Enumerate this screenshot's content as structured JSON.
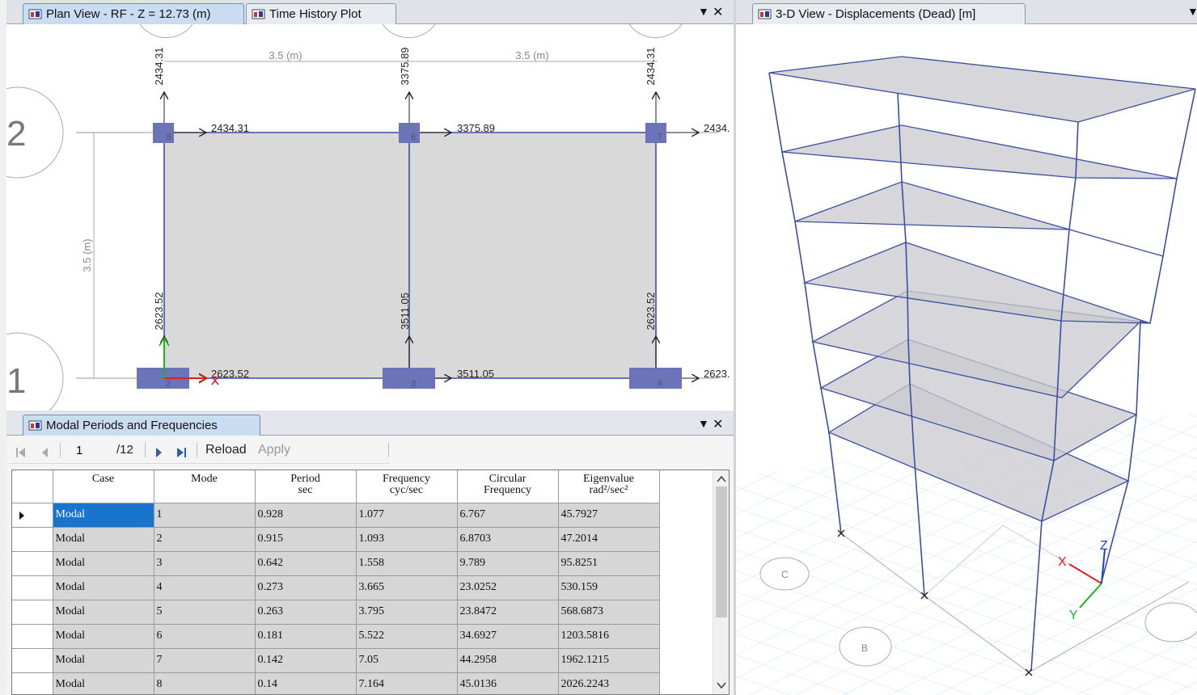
{
  "plan_view": {
    "tab_plan": "Plan View - RF - Z = 12.73 (m)",
    "tab_history": "Time History Plot",
    "dim_top_left": "3.5 (m)",
    "dim_top_right": "3.5 (m)",
    "dim_left": "3.5 (m)",
    "grid_bubble_top": "2",
    "grid_bubble_bottom": "1",
    "top_vert_labels": [
      "2434.31",
      "3375.89",
      "2434.31"
    ],
    "top_horiz_labels": [
      "2434.31",
      "3375.89",
      "2434."
    ],
    "bottom_vert_labels": [
      "2623.52",
      "3511.05",
      "2623.52"
    ],
    "bottom_horiz_labels": [
      "2623.52",
      "3511.05",
      "2623."
    ],
    "joint_labels_top": [
      "5",
      "6",
      "7"
    ],
    "joint_labels_bottom": [
      "2",
      "3",
      "4"
    ]
  },
  "view3d": {
    "tab": "3-D View  - Displacements (Dead)  [m]",
    "axis_x": "X",
    "axis_y": "Y",
    "axis_z": "Z",
    "bubble_a": "C",
    "bubble_b": "B"
  },
  "modal": {
    "tab": "Modal Periods and Frequencies",
    "page": "1",
    "page_total": "/12",
    "reload": "Reload",
    "apply": "Apply",
    "columns": [
      {
        "line1": "Case",
        "line2": ""
      },
      {
        "line1": "Mode",
        "line2": ""
      },
      {
        "line1": "Period",
        "line2": "sec"
      },
      {
        "line1": "Frequency",
        "line2": "cyc/sec"
      },
      {
        "line1": "Circular",
        "line2": "Frequency"
      },
      {
        "line1": "Eigenvalue",
        "line2": "rad²/sec²"
      }
    ],
    "rows": [
      [
        "Modal",
        "1",
        "0.928",
        "1.077",
        "6.767",
        "45.7927"
      ],
      [
        "Modal",
        "2",
        "0.915",
        "1.093",
        "6.8703",
        "47.2014"
      ],
      [
        "Modal",
        "3",
        "0.642",
        "1.558",
        "9.789",
        "95.8251"
      ],
      [
        "Modal",
        "4",
        "0.273",
        "3.665",
        "23.0252",
        "530.159"
      ],
      [
        "Modal",
        "5",
        "0.263",
        "3.795",
        "23.8472",
        "568.6873"
      ],
      [
        "Modal",
        "6",
        "0.181",
        "5.522",
        "34.6927",
        "1203.5816"
      ],
      [
        "Modal",
        "7",
        "0.142",
        "7.05",
        "44.2958",
        "1962.1215"
      ],
      [
        "Modal",
        "8",
        "0.14",
        "7.164",
        "45.0136",
        "2026.2243"
      ]
    ]
  },
  "colors": {
    "accent": "#1874cd",
    "column_fill": "#6b74b8",
    "frame_line": "#3b4fa0",
    "slab_fill": "#d9d9d9"
  }
}
